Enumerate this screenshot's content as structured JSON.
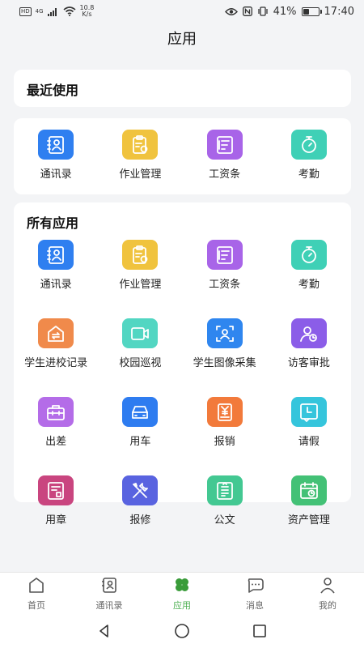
{
  "status_bar": {
    "hd": "HD",
    "network": "4G",
    "net_speed_value": "10.8",
    "net_speed_unit": "K/s",
    "battery_percent": "41%",
    "battery_level": 0.41,
    "time": "17:40"
  },
  "page_title": "应用",
  "recent": {
    "title": "最近使用",
    "items": [
      {
        "label": "通讯录",
        "icon": "contacts-icon",
        "color": "#2f7ff0"
      },
      {
        "label": "作业管理",
        "icon": "homework-icon",
        "color": "#f0c33e"
      },
      {
        "label": "工资条",
        "icon": "payslip-icon",
        "color": "#a864e8"
      },
      {
        "label": "考勤",
        "icon": "stopwatch-icon",
        "color": "#3fd0b6"
      }
    ]
  },
  "all_apps": {
    "title": "所有应用",
    "items": [
      {
        "label": "通讯录",
        "icon": "contacts-icon",
        "color": "#2f7ff0"
      },
      {
        "label": "作业管理",
        "icon": "homework-icon",
        "color": "#f0c33e"
      },
      {
        "label": "工资条",
        "icon": "payslip-icon",
        "color": "#a864e8"
      },
      {
        "label": "考勤",
        "icon": "stopwatch-icon",
        "color": "#3fd0b6"
      },
      {
        "label": "学生进校记录",
        "icon": "entry-record-icon",
        "color": "#f08a4b"
      },
      {
        "label": "校园巡视",
        "icon": "camera-icon",
        "color": "#52d6c2"
      },
      {
        "label": "学生图像采集",
        "icon": "face-capture-icon",
        "color": "#2f86ef"
      },
      {
        "label": "访客审批",
        "icon": "visitor-icon",
        "color": "#8b5de8"
      },
      {
        "label": "出差",
        "icon": "suitcase-icon",
        "color": "#b46ce8"
      },
      {
        "label": "用车",
        "icon": "car-icon",
        "color": "#2e7cf0"
      },
      {
        "label": "报销",
        "icon": "reimburse-icon",
        "color": "#f27a3b"
      },
      {
        "label": "请假",
        "icon": "leave-icon",
        "color": "#35c5dc"
      },
      {
        "label": "用章",
        "icon": "seal-icon",
        "color": "#c9457f"
      },
      {
        "label": "报修",
        "icon": "repair-icon",
        "color": "#5963e0"
      },
      {
        "label": "公文",
        "icon": "document-icon",
        "color": "#43c892"
      },
      {
        "label": "资产管理",
        "icon": "asset-icon",
        "color": "#43c176"
      }
    ]
  },
  "bottom_nav": [
    {
      "label": "首页",
      "icon": "home-icon",
      "active": false
    },
    {
      "label": "通讯录",
      "icon": "contacts-icon",
      "active": false
    },
    {
      "label": "应用",
      "icon": "clover-icon",
      "active": true
    },
    {
      "label": "消息",
      "icon": "message-icon",
      "active": false
    },
    {
      "label": "我的",
      "icon": "profile-icon",
      "active": false
    }
  ],
  "colors": {
    "accent": "#4caf50",
    "background": "#f3f4f6"
  }
}
